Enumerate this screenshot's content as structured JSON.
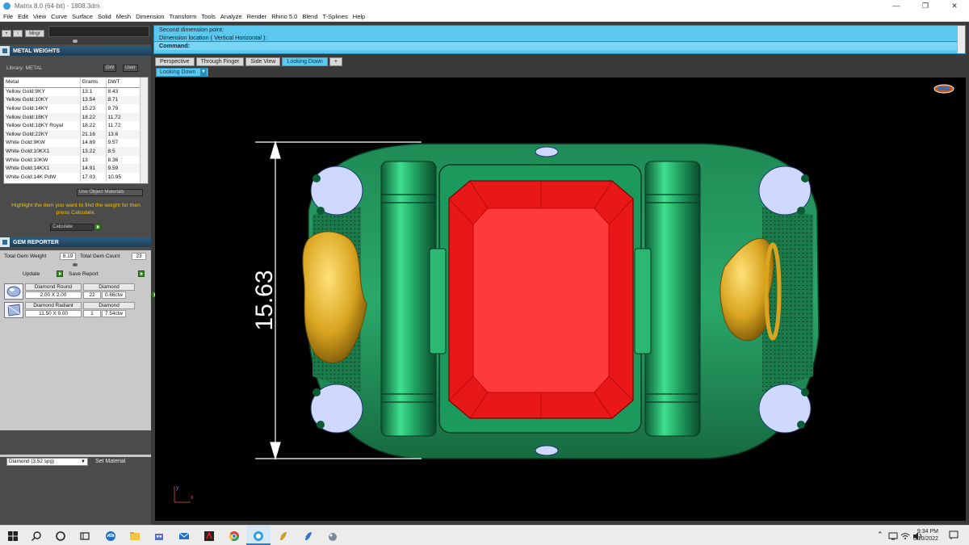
{
  "window": {
    "title": "Matrix 8.0 (64-bit) - 1808.3dm",
    "controls": [
      "—",
      "❐",
      "✕"
    ]
  },
  "menu": [
    "File",
    "Edit",
    "View",
    "Curve",
    "Surface",
    "Solid",
    "Mesh",
    "Dimension",
    "Transform",
    "Tools",
    "Analyze",
    "Render",
    "Rhino 5.0",
    "Blend",
    "T-Splines",
    "Help"
  ],
  "toolbar": {
    "plus": "+",
    "up": "↑",
    "mngr": "Mngr"
  },
  "metal_weights": {
    "header": "METAL WEIGHTS",
    "library_label": "Library: METAL",
    "gw_btn": "GW",
    "user_btn": "User",
    "columns": [
      "Metal",
      "Grams",
      "DWT"
    ],
    "rows": [
      [
        "Yellow Gold:9KY",
        "13.1",
        "8.43"
      ],
      [
        "Yellow Gold:10KY",
        "13.54",
        "8.71"
      ],
      [
        "Yellow Gold:14KY",
        "15.23",
        "9.79"
      ],
      [
        "Yellow Gold:18KY",
        "18.22",
        "11.72"
      ],
      [
        "Yellow Gold:18KY Royal",
        "18.22",
        "11.72"
      ],
      [
        "Yellow Gold:22KY",
        "21.16",
        "13.6"
      ],
      [
        "White Gold:9KW",
        "14.89",
        "9.57"
      ],
      [
        "White Gold:10KX1",
        "13.22",
        "8.5"
      ],
      [
        "White Gold:10KW",
        "13",
        "8.36"
      ],
      [
        "White Gold:14KX1",
        "14.91",
        "9.59"
      ],
      [
        "White Gold:14K PdW",
        "17.03",
        "10.95"
      ]
    ],
    "use_object_materials": "Use Object Materials",
    "hint": "Highlight the item you want to find the weight for then press Calculate.",
    "calculate": "Calculate"
  },
  "gem_reporter": {
    "header": "GEM REPORTER",
    "total_weight_label": "Total Gem Weight",
    "total_weight": "8.19",
    "total_count_label": "Total Gem Count",
    "total_count": "23",
    "update": "Update",
    "save_report": "Save Report",
    "gems": [
      {
        "shape": "Diamond Round",
        "material": "Diamond",
        "size": "2.00 X 2.00",
        "qty": "22",
        "ctw": "0.66ctw"
      },
      {
        "shape": "Diamond Radiant",
        "material": "Diamond",
        "size": "11.50 X 9.00",
        "qty": "1",
        "ctw": "7.54ctw"
      }
    ],
    "material_select": "Diamond     (3.52 spg)",
    "set_material": "Set Material"
  },
  "command": {
    "line1": "Second dimension point:",
    "line2": "Dimension location ( Vertical  Horizontal ):",
    "prompt": "Command:"
  },
  "viewport": {
    "tabs": [
      "Perspective",
      "Through Finger",
      "Side View",
      "Looking Down",
      "+"
    ],
    "active_tab": "Looking Down",
    "label": "Looking Down",
    "dimension": "15.63",
    "axis_y": "y",
    "axis_x": "x"
  },
  "colors": {
    "accent": "#5bc8ee",
    "gem": "#ff2a2a",
    "metal": "#22a565",
    "gold": "#d9a520"
  },
  "taskbar": {
    "time": "9:34 PM",
    "date": "6/10/2022"
  }
}
